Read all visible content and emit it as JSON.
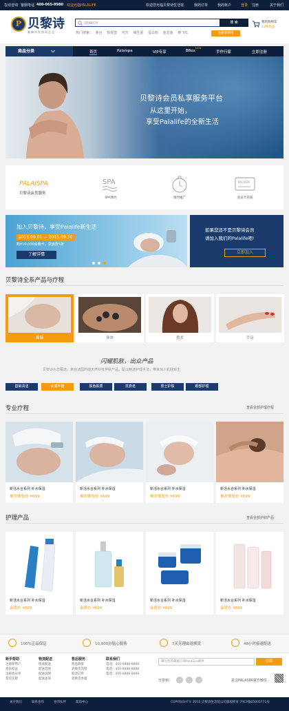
{
  "topbar": {
    "service": "在线咨询",
    "hotline_label": "客服电话",
    "hotline": "400-065-9980",
    "welcome": "欢迎光临PALALIFE",
    "greeting": "欢迎您光临贝黎诗生活馆",
    "my_order": "我的订单",
    "my_account": "我的账户",
    "login": "登录",
    "register": "注册",
    "about": "关于我们"
  },
  "header": {
    "logo_mark": "P",
    "logo_name": "贝黎诗",
    "logo_sub": "美嘛所发扬同品品",
    "search_placeholder": "SEARCH",
    "search_button": "搜 索",
    "hot_label": "热门搜索：",
    "hot_terms": [
      "茅台",
      "铁观音",
      "可乐",
      "维生素",
      "蛋白粉",
      "金龙鱼",
      "黄飞红"
    ],
    "vip_button": "注册享特权",
    "cart_line1": "我的购物车",
    "cart_line2": "12件商品"
  },
  "nav": {
    "category": "商品分类",
    "items": [
      "首页",
      "Palaispa",
      "VIP专享",
      "BBox",
      "手作行家",
      "立即注册"
    ],
    "bbox_badge": "NEW"
  },
  "hero": {
    "line1": "贝黎诗会员私享服务平台",
    "line2": "从这里开始，",
    "line3": "享受Palalife的全新生活"
  },
  "features": {
    "brand": "PALAISPA",
    "brand_sub": "贝黎诗会员服务",
    "items": [
      {
        "label": "SPA预约",
        "icon": "spa-icon"
      },
      {
        "label": "限时推广",
        "icon": "stopwatch-icon"
      },
      {
        "label": "会员卡充值",
        "icon": "card-icon"
      }
    ]
  },
  "promo_left": {
    "title": "加入贝黎诗，享受Palalife新生活",
    "date": "2015.09.01 — 2015.09.30",
    "offer": "购¥10,000会籍卡，享消费5折",
    "button": "了解详情"
  },
  "promo_right": {
    "line1": "如果您还不是贝黎诗会员",
    "line2": "请加入我们的Palalife吧!",
    "button": "立即加入"
  },
  "series": {
    "title": "贝黎诗全系产品与疗程",
    "categories": [
      {
        "label": "面部"
      },
      {
        "label": "身体"
      },
      {
        "label": "秀发"
      },
      {
        "label": "手足"
      }
    ],
    "slogan": "闪耀肌肤，出众产品",
    "slogan_sub": "贝黎诗为您甄选，来自法国的纯天然科技护肤产品，配以精湛护理手法，带来惊人肌肤新生"
  },
  "tabs": [
    "基础清洁",
    "水润平衡",
    "肤色肤质",
    "抗衰老",
    "男士护肤",
    "眼部护理"
  ],
  "treatments": {
    "title": "专业疗程",
    "more": "查看全部护理疗程",
    "cards": [
      {
        "name": "新活水合系列 补水保湿",
        "price": "单次体验价 ¥699"
      },
      {
        "name": "新活水合系列 补水保湿",
        "price": "单次体验价 ¥699"
      },
      {
        "name": "新活水合系列 补水保湿",
        "price": "单次体验价 ¥699"
      },
      {
        "name": "新活水合系列 补水保湿",
        "price": "单次体验价 ¥699"
      }
    ]
  },
  "products": {
    "title": "护理产品",
    "more": "查看全部护肤产品",
    "cards": [
      {
        "name": "新活水合系列 补水保湿",
        "price": "会员价 ¥699"
      },
      {
        "name": "新活水合系列 补水保湿",
        "price": "会员价 ¥699"
      },
      {
        "name": "新活水合系列 补水保湿",
        "price": "会员价 ¥699"
      },
      {
        "name": "新活水合系列 补水保湿",
        "price": "会员价 ¥699"
      }
    ]
  },
  "guarantees": [
    "100%正品保证",
    "10,000分贴心服务",
    "7天无理由退换货",
    "48小时极速配送"
  ],
  "footer": {
    "cols": [
      {
        "head": "新手帮助",
        "items": [
          "注册新用户",
          "会员权益",
          "注册会员享",
          "常见问题"
        ]
      },
      {
        "head": "物流配送",
        "items": [
          "快速配送",
          "配送范围",
          "配送说明",
          "配送查询"
        ]
      },
      {
        "head": "售后服务",
        "items": [
          "售后政策",
          "退换货流程",
          "取消订单",
          "退换货办理"
        ]
      },
      {
        "head": "联系我们",
        "items": [
          "电话：400-8888-8888",
          "电话：400-8888-8888",
          "电话：400-8888-8888"
        ]
      }
    ],
    "subscribe_placeholder": "填写您的邮箱订阅PalaSpa邮件",
    "subscribe_button": "订阅",
    "share_label": "分享到：",
    "follow": "关注PALASPA官方微信"
  },
  "bottom": {
    "links": [
      "关于我们",
      "联系合作",
      "合作伙伴",
      "帮助中心"
    ],
    "copyright": "COPYRIGHT© 2015 贝黎诗生活馆公司版权所有 沪ICP备05005771号"
  },
  "colors": {
    "navy": "#0d1f3b",
    "accent": "#f39c12",
    "brand": "#1a3a6b"
  }
}
